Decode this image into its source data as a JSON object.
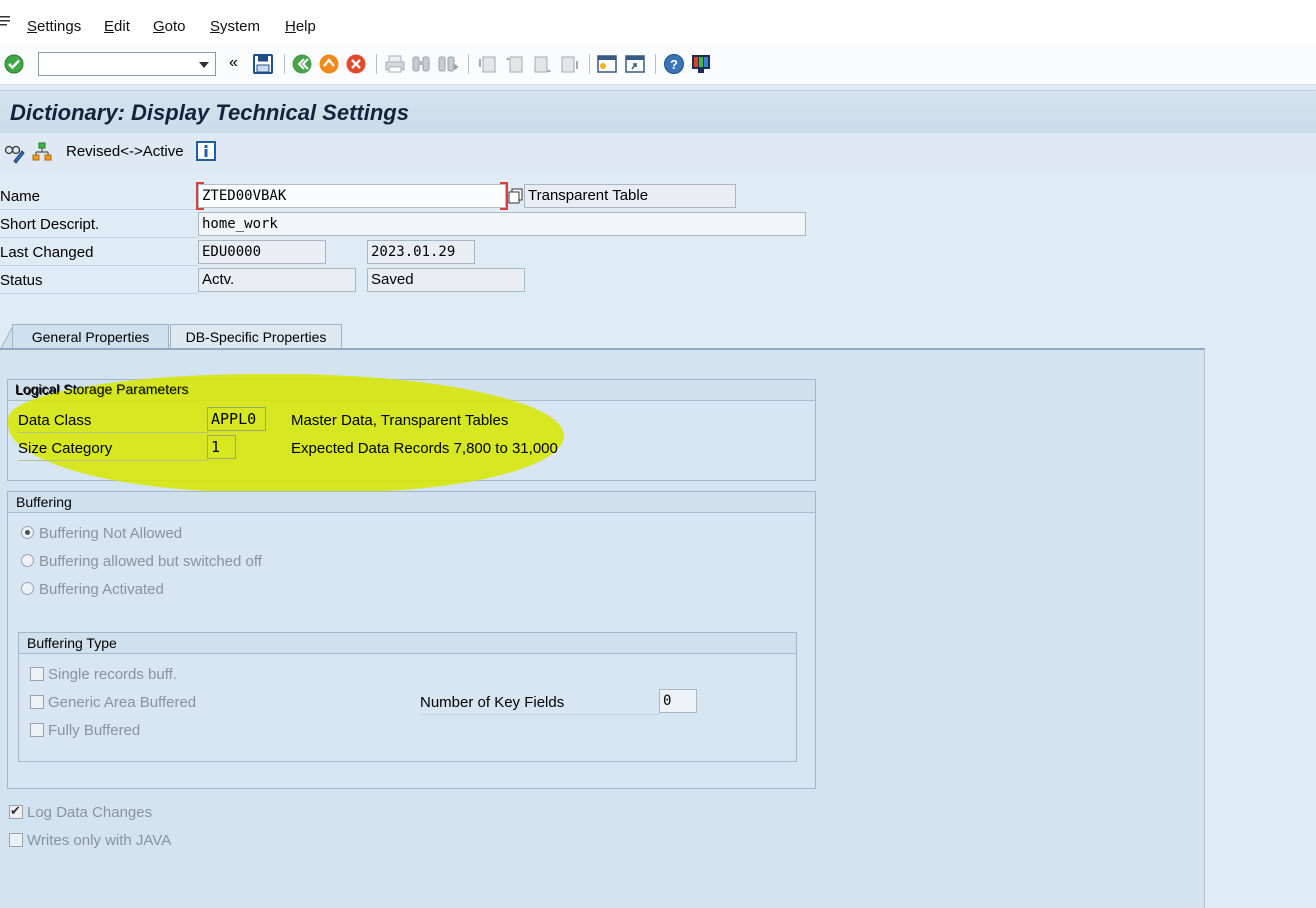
{
  "menu": {
    "items": [
      {
        "label": "Settings"
      },
      {
        "label": "Edit"
      },
      {
        "label": "Goto"
      },
      {
        "label": "System"
      },
      {
        "label": "Help"
      }
    ]
  },
  "toolbar": {
    "command_field_value": "",
    "icons": [
      "enter-icon",
      "history-dropdown-icon",
      "collapse-icon",
      "save-icon",
      "back-icon",
      "exit-icon",
      "cancel-icon",
      "print-icon",
      "find-icon",
      "find-next-icon",
      "first-page-icon",
      "previous-page-icon",
      "next-page-icon",
      "last-page-icon",
      "new-session-icon",
      "create-shortcut-icon",
      "help-icon",
      "layout-menu-icon"
    ]
  },
  "title": "Dictionary: Display Technical Settings",
  "app_toolbar": {
    "revised_active_label": "Revised<->Active",
    "icons": [
      "display-change-icon",
      "hierarchy-icon",
      "info-icon"
    ]
  },
  "header": {
    "name_label": "Name",
    "name_value": "ZTED00VBAK",
    "table_type": "Transparent Table",
    "short_desc_label": "Short Descript.",
    "short_desc_value": "home_work",
    "last_changed_label": "Last Changed",
    "last_changed_user": "EDU0000",
    "last_changed_date": "2023.01.29",
    "status_label": "Status",
    "status_value": "Actv.",
    "status_saved": "Saved"
  },
  "tabs": [
    {
      "label": "General Properties",
      "active": true
    },
    {
      "label": "DB-Specific Properties",
      "active": false
    }
  ],
  "logical_storage": {
    "title": "Logical Storage Parameters",
    "data_class_label": "Data Class",
    "data_class_value": "APPL0",
    "data_class_desc": "Master Data, Transparent Tables",
    "size_category_label": "Size Category",
    "size_category_value": "1",
    "size_category_desc": "Expected Data Records 7,800 to 31,000",
    "highlight_color": "#d6e800"
  },
  "buffering": {
    "title": "Buffering",
    "options": [
      {
        "label": "Buffering Not Allowed",
        "selected": true
      },
      {
        "label": "Buffering allowed but switched off",
        "selected": false
      },
      {
        "label": "Buffering Activated",
        "selected": false
      }
    ]
  },
  "buffering_type": {
    "title": "Buffering Type",
    "single_records": "Single records buff.",
    "generic_area": "Generic Area Buffered",
    "fully_buffered": "Fully Buffered",
    "num_key_fields_label": "Number of Key Fields",
    "num_key_fields_value": "0"
  },
  "log_data_changes": {
    "label": "Log Data Changes",
    "checked": true
  },
  "writes_only_java": {
    "label": "Writes only with JAVA",
    "checked": false
  }
}
